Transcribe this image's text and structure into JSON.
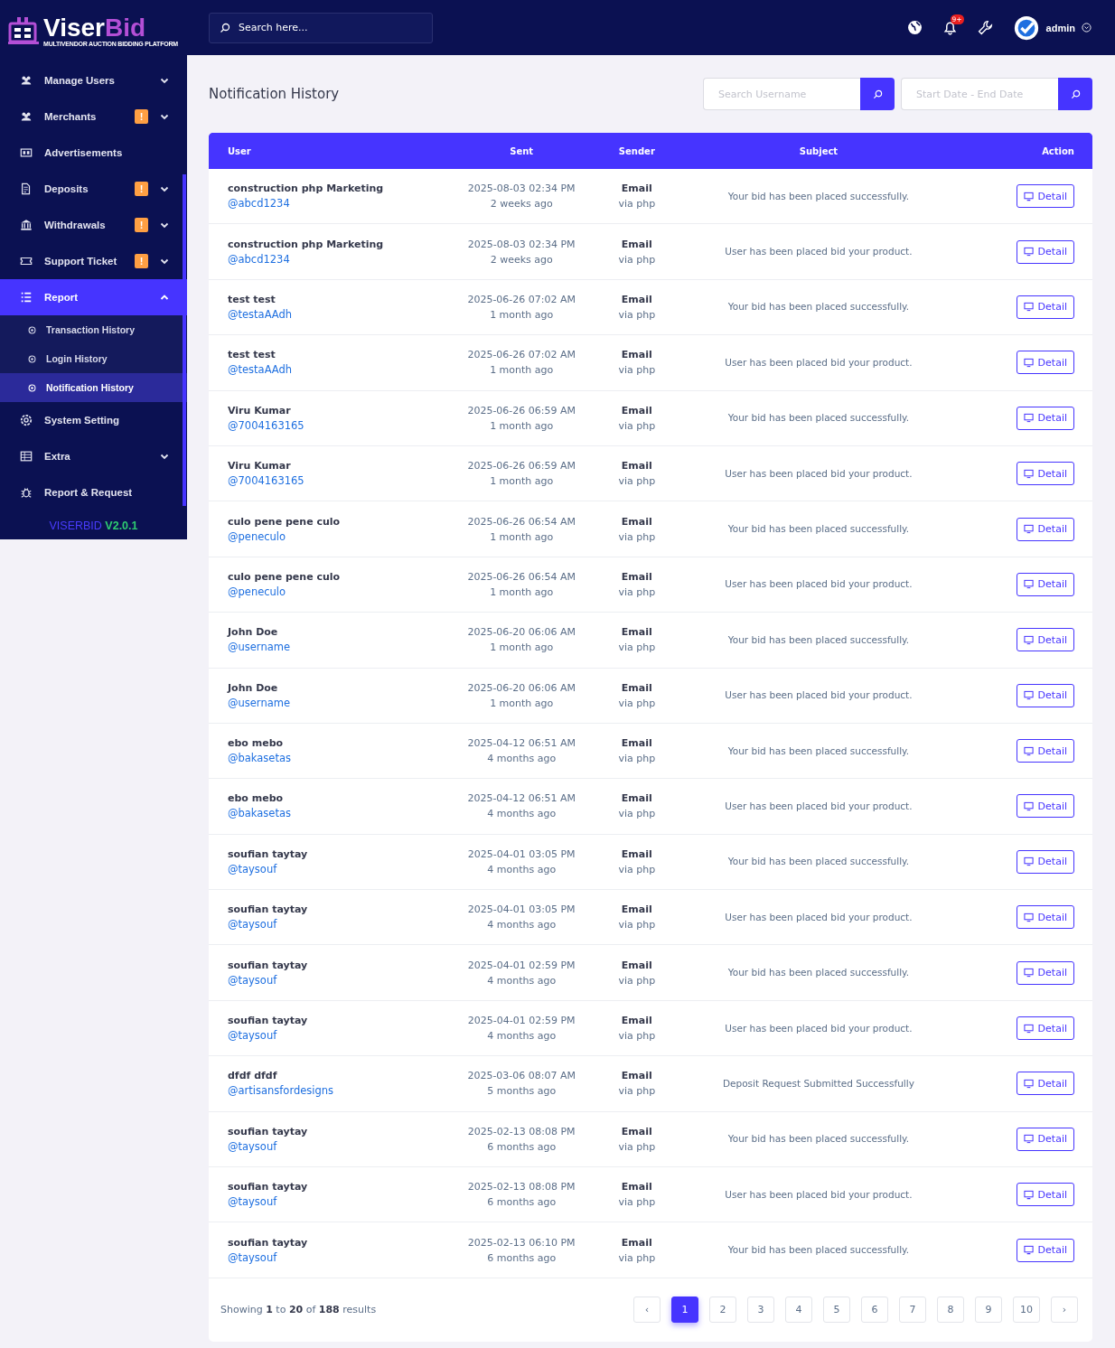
{
  "brand": {
    "name_a": "Viser",
    "name_b": "Bid",
    "tagline": "MULTIVENDOR AUCTION BIDDING PLATFORM"
  },
  "sidebar": {
    "items": [
      {
        "label": "Manage Users",
        "alert": false,
        "expandable": true,
        "expanded": false,
        "selected": false
      },
      {
        "label": "Merchants",
        "alert": true,
        "alert_text": "!",
        "expandable": true,
        "expanded": false,
        "selected": false
      },
      {
        "label": "Advertisements",
        "alert": false,
        "expandable": false,
        "expanded": false,
        "selected": false
      },
      {
        "label": "Deposits",
        "alert": true,
        "alert_text": "!",
        "expandable": true,
        "expanded": false,
        "selected": false
      },
      {
        "label": "Withdrawals",
        "alert": true,
        "alert_text": "!",
        "expandable": true,
        "expanded": false,
        "selected": false
      },
      {
        "label": "Support Ticket",
        "alert": true,
        "alert_text": "!",
        "expandable": true,
        "expanded": false,
        "selected": false
      },
      {
        "label": "Report",
        "alert": false,
        "expandable": true,
        "expanded": true,
        "selected": true,
        "children": [
          {
            "label": "Transaction History",
            "selected": false
          },
          {
            "label": "Login History",
            "selected": false
          },
          {
            "label": "Notification History",
            "selected": true
          }
        ]
      },
      {
        "label": "System Setting",
        "alert": false,
        "expandable": false,
        "expanded": false,
        "selected": false
      },
      {
        "label": "Extra",
        "alert": false,
        "expandable": true,
        "expanded": false,
        "selected": false
      },
      {
        "label": "Report & Request",
        "alert": false,
        "expandable": false,
        "expanded": false,
        "selected": false
      }
    ],
    "version_name": "VISERBID",
    "version": "V2.0.1"
  },
  "topbar": {
    "search_placeholder": "Search here...",
    "notification_count": "9+",
    "user": "admin"
  },
  "page": {
    "title": "Notification History",
    "username_placeholder": "Search Username",
    "date_placeholder": "Start Date - End Date"
  },
  "table": {
    "columns": [
      "User",
      "Sent",
      "Sender",
      "Subject",
      "Action"
    ],
    "rows": [
      {
        "name": "construction php Marketing",
        "username": "@abcd1234",
        "sent": "2025-08-03 02:34 PM",
        "ago": "2 weeks ago",
        "sender": "Email",
        "via": "via php",
        "subject": "Your bid has been placed successfully.",
        "action": "Detail"
      },
      {
        "name": "construction php Marketing",
        "username": "@abcd1234",
        "sent": "2025-08-03 02:34 PM",
        "ago": "2 weeks ago",
        "sender": "Email",
        "via": "via php",
        "subject": "User has been placed bid your product.",
        "action": "Detail"
      },
      {
        "name": "test test",
        "username": "@testaAAdh",
        "sent": "2025-06-26 07:02 AM",
        "ago": "1 month ago",
        "sender": "Email",
        "via": "via php",
        "subject": "Your bid has been placed successfully.",
        "action": "Detail"
      },
      {
        "name": "test test",
        "username": "@testaAAdh",
        "sent": "2025-06-26 07:02 AM",
        "ago": "1 month ago",
        "sender": "Email",
        "via": "via php",
        "subject": "User has been placed bid your product.",
        "action": "Detail"
      },
      {
        "name": "Viru Kumar",
        "username": "@7004163165",
        "sent": "2025-06-26 06:59 AM",
        "ago": "1 month ago",
        "sender": "Email",
        "via": "via php",
        "subject": "Your bid has been placed successfully.",
        "action": "Detail"
      },
      {
        "name": "Viru Kumar",
        "username": "@7004163165",
        "sent": "2025-06-26 06:59 AM",
        "ago": "1 month ago",
        "sender": "Email",
        "via": "via php",
        "subject": "User has been placed bid your product.",
        "action": "Detail"
      },
      {
        "name": "culo pene pene culo",
        "username": "@peneculo",
        "sent": "2025-06-26 06:54 AM",
        "ago": "1 month ago",
        "sender": "Email",
        "via": "via php",
        "subject": "Your bid has been placed successfully.",
        "action": "Detail"
      },
      {
        "name": "culo pene pene culo",
        "username": "@peneculo",
        "sent": "2025-06-26 06:54 AM",
        "ago": "1 month ago",
        "sender": "Email",
        "via": "via php",
        "subject": "User has been placed bid your product.",
        "action": "Detail"
      },
      {
        "name": "John Doe",
        "username": "@username",
        "sent": "2025-06-20 06:06 AM",
        "ago": "1 month ago",
        "sender": "Email",
        "via": "via php",
        "subject": "Your bid has been placed successfully.",
        "action": "Detail"
      },
      {
        "name": "John Doe",
        "username": "@username",
        "sent": "2025-06-20 06:06 AM",
        "ago": "1 month ago",
        "sender": "Email",
        "via": "via php",
        "subject": "User has been placed bid your product.",
        "action": "Detail"
      },
      {
        "name": "ebo mebo",
        "username": "@bakasetas",
        "sent": "2025-04-12 06:51 AM",
        "ago": "4 months ago",
        "sender": "Email",
        "via": "via php",
        "subject": "Your bid has been placed successfully.",
        "action": "Detail"
      },
      {
        "name": "ebo mebo",
        "username": "@bakasetas",
        "sent": "2025-04-12 06:51 AM",
        "ago": "4 months ago",
        "sender": "Email",
        "via": "via php",
        "subject": "User has been placed bid your product.",
        "action": "Detail"
      },
      {
        "name": "soufian taytay",
        "username": "@taysouf",
        "sent": "2025-04-01 03:05 PM",
        "ago": "4 months ago",
        "sender": "Email",
        "via": "via php",
        "subject": "Your bid has been placed successfully.",
        "action": "Detail"
      },
      {
        "name": "soufian taytay",
        "username": "@taysouf",
        "sent": "2025-04-01 03:05 PM",
        "ago": "4 months ago",
        "sender": "Email",
        "via": "via php",
        "subject": "User has been placed bid your product.",
        "action": "Detail"
      },
      {
        "name": "soufian taytay",
        "username": "@taysouf",
        "sent": "2025-04-01 02:59 PM",
        "ago": "4 months ago",
        "sender": "Email",
        "via": "via php",
        "subject": "Your bid has been placed successfully.",
        "action": "Detail"
      },
      {
        "name": "soufian taytay",
        "username": "@taysouf",
        "sent": "2025-04-01 02:59 PM",
        "ago": "4 months ago",
        "sender": "Email",
        "via": "via php",
        "subject": "User has been placed bid your product.",
        "action": "Detail"
      },
      {
        "name": "dfdf dfdf",
        "username": "@artisansfordesigns",
        "sent": "2025-03-06 08:07 AM",
        "ago": "5 months ago",
        "sender": "Email",
        "via": "via php",
        "subject": "Deposit Request Submitted Successfully",
        "action": "Detail"
      },
      {
        "name": "soufian taytay",
        "username": "@taysouf",
        "sent": "2025-02-13 08:08 PM",
        "ago": "6 months ago",
        "sender": "Email",
        "via": "via php",
        "subject": "Your bid has been placed successfully.",
        "action": "Detail"
      },
      {
        "name": "soufian taytay",
        "username": "@taysouf",
        "sent": "2025-02-13 08:08 PM",
        "ago": "6 months ago",
        "sender": "Email",
        "via": "via php",
        "subject": "User has been placed bid your product.",
        "action": "Detail"
      },
      {
        "name": "soufian taytay",
        "username": "@taysouf",
        "sent": "2025-02-13 06:10 PM",
        "ago": "6 months ago",
        "sender": "Email",
        "via": "via php",
        "subject": "Your bid has been placed successfully.",
        "action": "Detail"
      }
    ]
  },
  "pagination": {
    "summary": "Showing **1** to **20** of **188** results",
    "prev": "‹",
    "next": "›",
    "pages": [
      {
        "label": "1",
        "selected": true
      },
      {
        "label": "2",
        "selected": false
      },
      {
        "label": "3",
        "selected": false
      },
      {
        "label": "4",
        "selected": false
      },
      {
        "label": "5",
        "selected": false
      },
      {
        "label": "6",
        "selected": false
      },
      {
        "label": "7",
        "selected": false
      },
      {
        "label": "8",
        "selected": false
      },
      {
        "label": "9",
        "selected": false
      },
      {
        "label": "10",
        "selected": false
      }
    ]
  }
}
